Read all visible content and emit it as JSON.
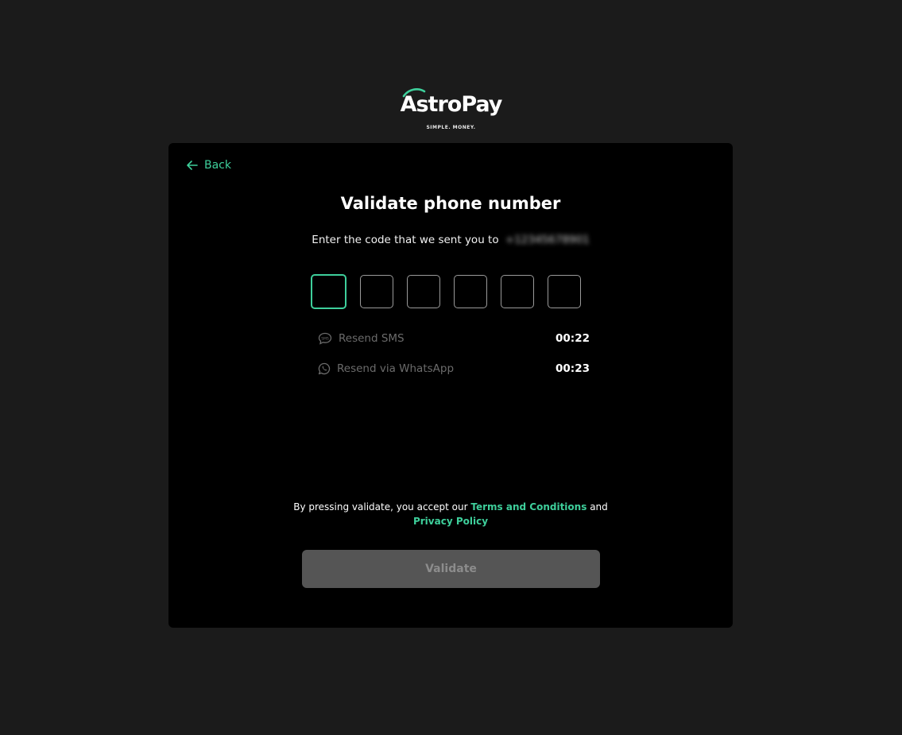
{
  "logo": {
    "name": "AstroPay",
    "tagline": "SIMPLE. MONEY."
  },
  "card": {
    "back_label": "Back",
    "title": "Validate phone number",
    "subtitle": "Enter the code that we sent you to",
    "phone_masked": "+12345678901",
    "code_boxes": [
      "",
      "",
      "",
      "",
      "",
      ""
    ],
    "resend_sms": {
      "label": "Resend SMS",
      "timer": "00:22",
      "icon": "sms-bubble-icon"
    },
    "resend_whatsapp": {
      "label": "Resend via WhatsApp",
      "timer": "00:23",
      "icon": "whatsapp-icon"
    },
    "terms": {
      "prefix": "By pressing validate, you accept our",
      "terms_link": "Terms and Conditions",
      "conjunction": "and",
      "privacy_link": "Privacy Policy"
    },
    "validate_label": "Validate"
  },
  "colors": {
    "background": "#1b1b1b",
    "card": "#000000",
    "accent": "#3ecf9b",
    "button_disabled": "#555555"
  }
}
